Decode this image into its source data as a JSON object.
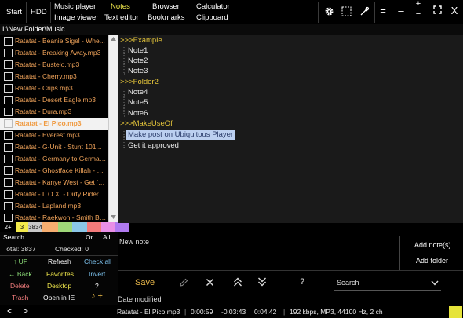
{
  "toolbar": {
    "start": "Start",
    "hdd": "HDD",
    "music_player": "Music player",
    "notes": "Notes",
    "browser": "Browser",
    "calculator": "Calculator",
    "image_viewer": "Image viewer",
    "text_editor": "Text editor",
    "bookmarks": "Bookmarks",
    "clipboard": "Clipboard"
  },
  "window_controls": {
    "equals": "=",
    "minimize": "–",
    "plus": "+",
    "minus": "−",
    "close": "X"
  },
  "path": "I:\\New Folder\\Music",
  "files": [
    "Ratatat - Beanie Sigel - Whe...",
    "Ratatat - Breaking Away.mp3",
    "Ratatat - Bustelo.mp3",
    "Ratatat - Cherry.mp3",
    "Ratatat - Crips.mp3",
    "Ratatat - Desert Eagle.mp3",
    "Ratatat - Dura.mp3",
    "Ratatat - El Pico.mp3",
    "Ratatat - Everest.mp3",
    "Ratatat - G-Unit - Stunt 101...",
    "Ratatat - Germany to German...",
    "Ratatat - Ghostface Killah - R...",
    "Ratatat - Kanye West - Get 'e...",
    "Ratatat - L.O.X. - Dirty Riders...",
    "Ratatat - Lapland.mp3",
    "Ratatat - Raekwon - Smith Br..."
  ],
  "selected_file_index": 7,
  "color_strip": {
    "label": "2+",
    "count_short": "3",
    "count_long": "3834",
    "colors": [
      "#f3ea4c",
      "#c8c8c8",
      "#f6ae70",
      "#9fd879",
      "#8bc7e8",
      "#f37b7b",
      "#e98fe6",
      "#b07af0"
    ]
  },
  "left_panel": {
    "search": "Search",
    "or": "Or",
    "all": "All",
    "total": "Total: 3837",
    "checked": "Checked: 0",
    "up": "↑ UP",
    "refresh": "Refresh",
    "check_all": "Check all",
    "back": "← Back",
    "favorites": "Favorites",
    "invert": "Invert",
    "delete": "Delete",
    "desktop": "Desktop",
    "help": "?",
    "trash": "Trash",
    "open_ie": "Open in IE",
    "add_music": "♪ +"
  },
  "tree": [
    {
      "label": ">>>Example",
      "type": "folder"
    },
    {
      "label": "Note1",
      "type": "note"
    },
    {
      "label": "Note2",
      "type": "note"
    },
    {
      "label": "Note3",
      "type": "note"
    },
    {
      "label": ">>>Folder2",
      "type": "folder"
    },
    {
      "label": "Note4",
      "type": "note"
    },
    {
      "label": "Note5",
      "type": "note"
    },
    {
      "label": "Note6",
      "type": "note"
    },
    {
      "label": ">>>MakeUseOf",
      "type": "folder"
    },
    {
      "label": "Make post on Ubiquitous Player",
      "type": "note",
      "highlighted": true
    },
    {
      "label": "Get it approved",
      "type": "note"
    }
  ],
  "notes_editor": {
    "new_note": "New note",
    "add_notes": "Add note(s)",
    "add_folder": "Add folder",
    "save": "Save",
    "help": "?",
    "search_placeholder": "Search",
    "date_modified": "Date modified"
  },
  "status": {
    "prev": "<",
    "next": ">",
    "track": "Ratatat - El Pico.mp3",
    "elapsed": "0:00:59",
    "remaining": "-0:03:43",
    "duration": "0:04:42",
    "info": "192 kbps, MP3, 44100 Hz, 2 ch",
    "sep": "|",
    "swatch_color": "#e6e43a"
  },
  "colors": {
    "file_text": "#f0a35a",
    "folder_text": "#e6c63a",
    "accent_yellow": "#f3ea4c",
    "save": "#e7b64a"
  }
}
